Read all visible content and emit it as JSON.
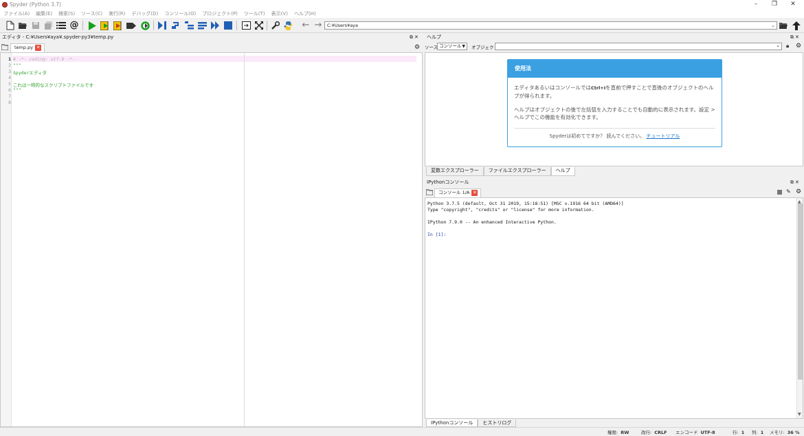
{
  "window": {
    "title": "Spyder (Python 3.7)",
    "minimize": "–",
    "restore": "❐",
    "close": "✕"
  },
  "menu": [
    "ファイル(A)",
    "編集(E)",
    "検索(S)",
    "ソース(C)",
    "実行(R)",
    "デバッグ(D)",
    "コンソール(O)",
    "プロジェクト(P)",
    "ツール(T)",
    "表示(V)",
    "ヘルプ(H)"
  ],
  "toolbar": {
    "path": "C:¥Users¥aya"
  },
  "editor": {
    "pane_title": "エディタ - C:¥Users¥aya¥.spyder-py3¥temp.py",
    "tab_label": "temp.py",
    "lines": [
      {
        "n": "1",
        "text": "# -*- coding: utf-8 -*-",
        "color": "#b0b0b0"
      },
      {
        "n": "2",
        "text": "\"\"\"",
        "color": "#2ca02c"
      },
      {
        "n": "3",
        "text": "Spyderエディタ",
        "color": "#2ca02c"
      },
      {
        "n": "4",
        "text": "",
        "color": "#2ca02c"
      },
      {
        "n": "5",
        "text": "これは一時的なスクリプトファイルです",
        "color": "#2ca02c"
      },
      {
        "n": "6",
        "text": "\"\"\"",
        "color": "#2ca02c"
      },
      {
        "n": "7",
        "text": "",
        "color": "#222"
      },
      {
        "n": "8",
        "text": "",
        "color": "#222"
      }
    ]
  },
  "help": {
    "pane_title": "ヘルプ",
    "source_label": "ソース",
    "source_value": "コンソール",
    "object_label": "オブジェクト",
    "card_title": "使用法",
    "para1_a": "エディタあるいはコンソールでは",
    "para1_key": "Ctrl+I",
    "para1_b": "を直前で押すことで直後のオブジェクトのヘルプが得られます。",
    "para2": "ヘルプはオブジェクトの後で左括弧を入力することでも自動的に表示されます。設定 > ヘルプでこの機能を有効化できます。",
    "footer_text": "Spyderは初めてですか？ 読んでください。",
    "footer_link": "チュートリアル",
    "bottom_tabs": [
      "変数エクスプローラー",
      "ファイルエクスプローラー",
      "ヘルプ"
    ]
  },
  "console": {
    "pane_title": "IPythonコンソール",
    "tab_label": "コンソール 1/A",
    "lines": [
      "Python 3.7.5 (default, Oct 31 2019, 15:18:51) [MSC v.1916 64 bit (AMD64)]",
      "Type \"copyright\", \"credits\" or \"license\" for more information.",
      "",
      "IPython 7.9.0 -- An enhanced Interactive Python.",
      "",
      "In [1]:"
    ],
    "bottom_tabs": [
      "IPythonコンソール",
      "ヒストリログ"
    ]
  },
  "status": {
    "perm_label": "権限:",
    "perm_value": "RW",
    "eol_label": "改行:",
    "eol_value": "CRLF",
    "enc_label": "エンコード",
    "enc_value": "UTF-8",
    "line_label": "行:",
    "line_value": "1",
    "col_label": "列:",
    "col_value": "1",
    "mem_label": "メモリ:",
    "mem_value": "36 %"
  }
}
